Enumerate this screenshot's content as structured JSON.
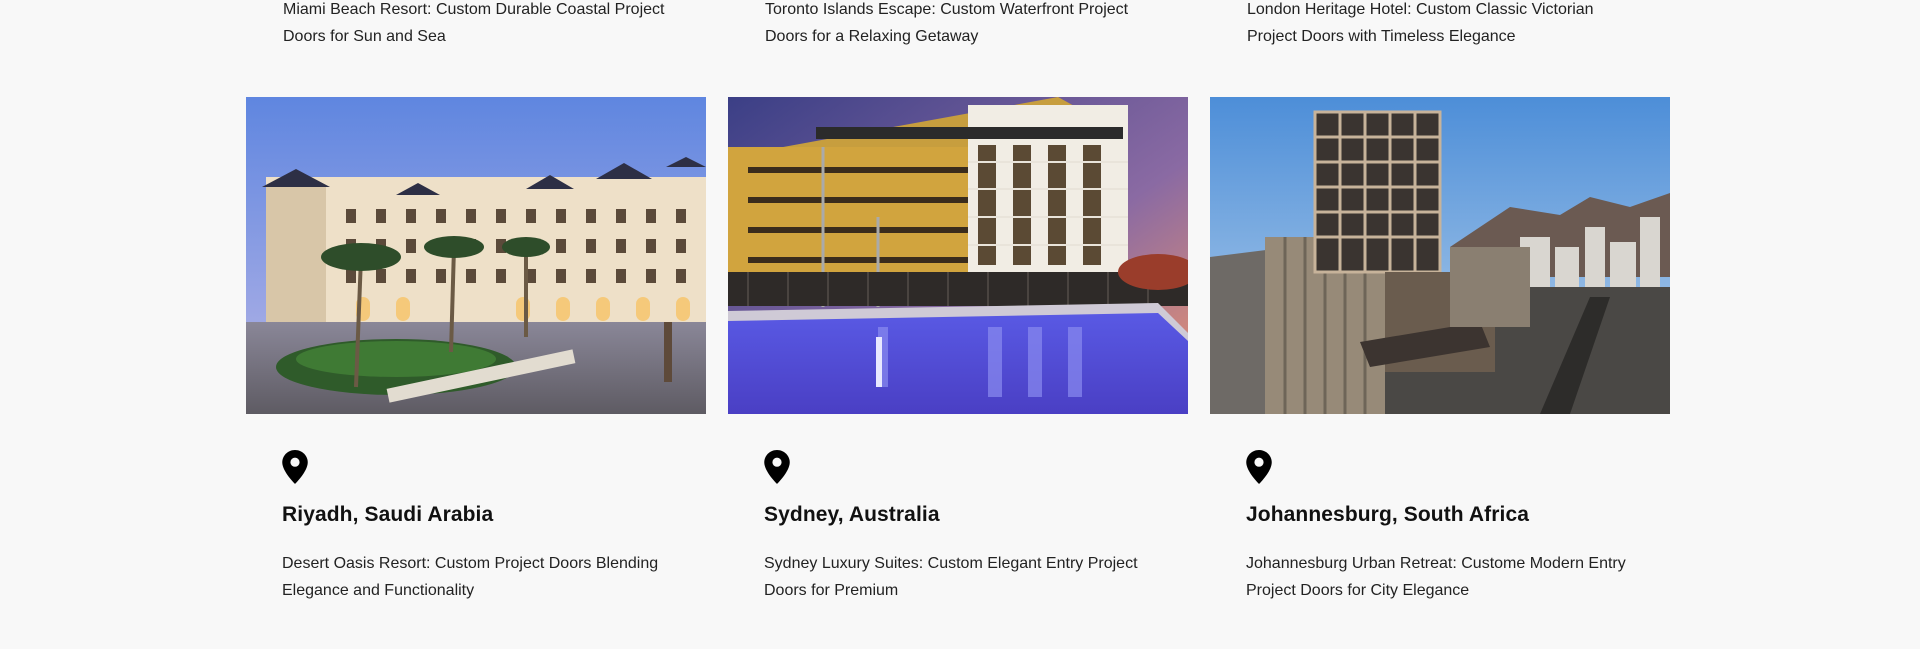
{
  "top_row": [
    {
      "description": "Miami Beach Resort: Custom Durable Coastal Project Doors for Sun and Sea"
    },
    {
      "description": "Toronto Islands Escape: Custom Waterfront Project Doors for a Relaxing Getaway"
    },
    {
      "description": "London Heritage Hotel: Custom Classic Victorian Project Doors with Timeless Elegance"
    }
  ],
  "cards": [
    {
      "title": "Riyadh, Saudi Arabia",
      "description": "Desert Oasis Resort: Custom Project Doors Blending Elegance and Functionality",
      "icon": "map-pin-icon"
    },
    {
      "title": "Sydney, Australia",
      "description": "Sydney Luxury Suites: Custom Elegant Entry Project Doors for Premium",
      "icon": "map-pin-icon"
    },
    {
      "title": "Johannesburg, South Africa",
      "description": "Johannesburg Urban Retreat: Custome Modern Entry Project Doors for City Elegance",
      "icon": "map-pin-icon"
    }
  ]
}
